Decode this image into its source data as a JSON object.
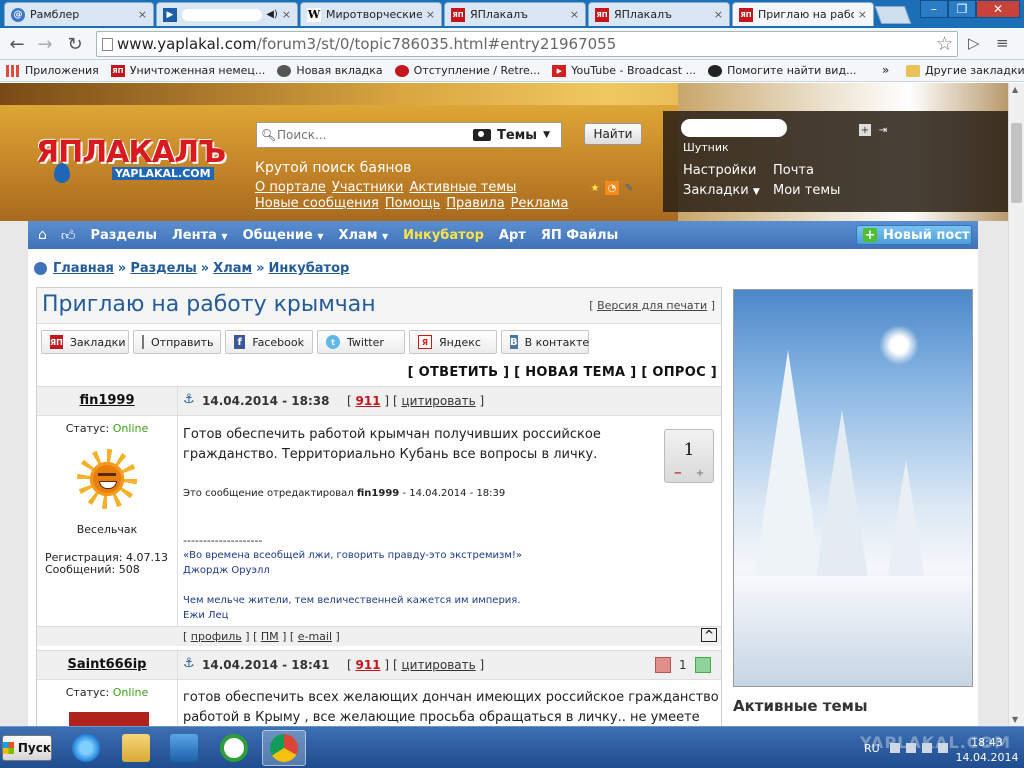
{
  "tabs": [
    {
      "title": "Рамблер",
      "icon": "rambler-icon"
    },
    {
      "title": "",
      "icon": "video-icon",
      "extra": "◀)"
    },
    {
      "title": "Миротворческие",
      "icon": "wikipedia-icon"
    },
    {
      "title": "ЯПлакалъ",
      "icon": "yaplakal-icon"
    },
    {
      "title": "ЯПлакалъ",
      "icon": "yaplakal-icon"
    },
    {
      "title": "Приглаю на работ",
      "icon": "yaplakal-icon"
    }
  ],
  "tab_close": "×",
  "window_buttons": {
    "minimize": "–",
    "restore": "❐",
    "close": "✕"
  },
  "toolbar": {
    "back": "←",
    "forward": "→",
    "reload": "↻",
    "url_host": "www.yaplakal.com",
    "url_path": "/forum3/st/0/topic786035.html#entry21967055",
    "star": "☆",
    "menu": "≡"
  },
  "bookmarks": [
    {
      "label": "Приложения",
      "icon": "apps-icon"
    },
    {
      "label": "Уничтоженная немец...",
      "icon": "yaplakal-icon"
    },
    {
      "label": "Новая вкладка",
      "icon": "hat-icon"
    },
    {
      "label": "Отступление / Retre...",
      "icon": "gear-icon"
    },
    {
      "label": "YouTube - Broadcast ...",
      "icon": "youtube-icon"
    },
    {
      "label": "Помогите найти вид...",
      "icon": "paw-icon"
    }
  ],
  "bookmarks_more": "»",
  "bookmarks_other": "Другие закладки",
  "site": {
    "logo_text": "ЯПЛАКАЛЪ",
    "logo_sub": "YAPLAKAL.COM",
    "search_placeholder": "Поиск...",
    "search_scope": "Темы",
    "search_button": "Найти",
    "tagline": "Крутой поиск баянов",
    "links": [
      "О портале",
      "Участники",
      "Активные темы",
      "Новые сообщения",
      "Помощь",
      "Правила",
      "Реклама"
    ],
    "user": {
      "rank": "Шутник",
      "settings": "Настройки",
      "mail": "Почта",
      "bookmarks": "Закладки",
      "my_topics": "Мои темы"
    },
    "nav": [
      "Разделы",
      "Лента",
      "Общение",
      "Хлам",
      "Инкубатор",
      "Арт",
      "ЯП Файлы"
    ],
    "new_post": "Новый пост"
  },
  "breadcrumb": [
    "Главная",
    "Разделы",
    "Хлам",
    "Инкубатор"
  ],
  "breadcrumb_sep": "»",
  "topic": {
    "title": "Приглаю на работу крымчан",
    "print_version": "Версия для печати",
    "share": [
      {
        "label": "Закладки",
        "icon": "yaplakal-icon"
      },
      {
        "label": "Отправить",
        "icon": "mail-icon"
      },
      {
        "label": "Facebook",
        "icon": "facebook-icon"
      },
      {
        "label": "Twitter",
        "icon": "twitter-icon"
      },
      {
        "label": "Яндекс",
        "icon": "yandex-icon"
      },
      {
        "label": "В контакте",
        "icon": "vk-icon"
      }
    ],
    "actions": "[ ОТВЕТИТЬ ] [ НОВАЯ ТЕМА ] [ ОПРОС ]"
  },
  "posts": [
    {
      "author": "fin1999",
      "date": "14.04.2014 - 18:38",
      "num": "911",
      "quote_label": "цитировать",
      "status_label": "Статус:",
      "status": "Online",
      "rank": "Весельчак",
      "registration": "Регистрация: 4.07.13",
      "messages": "Сообщений: 508",
      "body": "Готов обеспечить работой крымчан получивших российское гражданство. Территориально Кубань все вопросы в личку.",
      "edited_prefix": "Это сообщение отредактировал",
      "edited_user": "fin1999",
      "edited_date": "- 14.04.2014 - 18:39",
      "sig_dash": "--------------------",
      "sig_lines": [
        "«Во времена всеобщей лжи, говорить правду-это экстремизм!»",
        "Джордж Оруэлл",
        "",
        "Чем мельче жители, тем величественней кажется им империя.",
        "Ежи Лец"
      ],
      "rating": "1",
      "rating_minus": "−",
      "rating_plus": "+",
      "foot_profile": "профиль",
      "foot_pm": "ПМ",
      "foot_email": "e-mail",
      "foot_up": "^"
    },
    {
      "author": "Saint666ip",
      "date": "14.04.2014 - 18:41",
      "num": "911",
      "quote_label": "цитировать",
      "status_label": "Статус:",
      "status": "Online",
      "rating": "1",
      "body": "готов обеспечить всех желающих дончан имеющих российское гражданство работой в Крыму , все желающие просьба обращаться в личку.. не умеете"
    }
  ],
  "sidebar": {
    "active_topics": "Активные темы"
  },
  "taskbar": {
    "start": "Пуск",
    "lang": "RU",
    "time": "18:43",
    "date": "14.04.2014",
    "watermark": "YAPLAKAL.COM"
  }
}
